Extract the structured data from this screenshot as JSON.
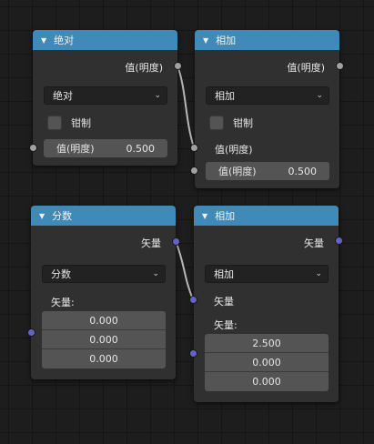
{
  "colors": {
    "header": "#3f8ab8",
    "node_body": "#303030",
    "value_socket": "#a1a1a1",
    "vector_socket": "#6363c7",
    "link": "#b8b8b8"
  },
  "icons": {
    "collapse": "triangle-down-icon",
    "dropdown": "chevron-down-icon"
  },
  "nodes": {
    "abs": {
      "title": "绝对",
      "output": "值(明度)",
      "operation": "绝对",
      "clamp_label": "钳制",
      "clamp_checked": false,
      "input_label": "值(明度)",
      "input_value": "0.500"
    },
    "add1": {
      "title": "相加",
      "output": "值(明度)",
      "operation": "相加",
      "clamp_label": "钳制",
      "clamp_checked": false,
      "input1_label": "值(明度)",
      "input2_label": "值(明度)",
      "input2_value": "0.500"
    },
    "fraction": {
      "title": "分数",
      "output": "矢量",
      "operation": "分数",
      "input_label": "矢量:",
      "values": [
        "0.000",
        "0.000",
        "0.000"
      ]
    },
    "add2": {
      "title": "相加",
      "output": "矢量",
      "operation": "相加",
      "input1_label": "矢量",
      "input2_label": "矢量:",
      "values": [
        "2.500",
        "0.000",
        "0.000"
      ]
    }
  }
}
